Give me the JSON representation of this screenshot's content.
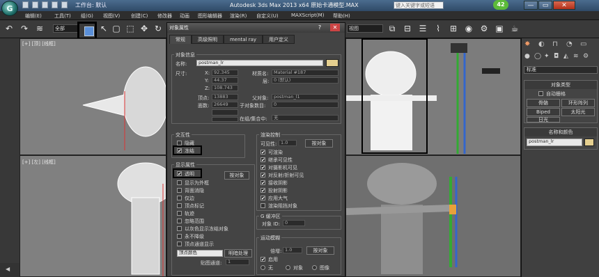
{
  "titlebar": {
    "app_badge": "G",
    "workspace": "工作台: 默认",
    "title": "Autodesk 3ds Max  2013 x64     原始卡通模型.MAX",
    "search_placeholder": "键入关键字或短语",
    "timer": "42",
    "min": "—",
    "max": "▭",
    "close": "✕"
  },
  "menu": [
    "编辑(E)",
    "工具(T)",
    "组(G)",
    "视图(V)",
    "创建(C)",
    "修改器",
    "动画",
    "图形编辑器",
    "渲染(R)",
    "自定义(U)",
    "MAXScript(M)",
    "帮助(H)"
  ],
  "toolbar": {
    "filter": "全部",
    "ref_coord": "视图",
    "icons": [
      "undo-icon",
      "redo-icon",
      "link-icon",
      "unlink-icon",
      "bind-icon",
      "select-icon",
      "cursor-icon",
      "rect-select-icon",
      "window-icon",
      "move-icon",
      "rotate-icon"
    ]
  },
  "viewports": {
    "top_left_label": "[+] [顶] [线框]",
    "bottom_left_label": "[+] [左] [线框]"
  },
  "dialog": {
    "title": "对象属性",
    "help": "?",
    "close": "✕",
    "tabs": [
      "常规",
      "高级照明",
      "mental ray",
      "用户定义"
    ],
    "info": {
      "group": "对象信息",
      "name_label": "名称:",
      "name_value": "postman_lr",
      "dims_label": "尺寸:",
      "x_label": "X:",
      "x": "92.345",
      "y_label": "Y:",
      "y": "44.37",
      "z_label": "Z:",
      "z": "108.743",
      "verts_label": "顶点:",
      "verts": "13883",
      "faces_label": "面数:",
      "faces": "26649",
      "material_label": "材质名:",
      "material": "Material #187",
      "layer_label": "层:",
      "layer": "0 (默认)",
      "parent_label": "父对象:",
      "parent": "postman_l1",
      "children_label": "子对象数目:",
      "children": "0",
      "group_label": "在组/集合中:",
      "group_value": "无"
    },
    "interactivity": {
      "group": "交互性",
      "hide": "隐藏",
      "freeze": "冻结"
    },
    "display": {
      "group": "显示属性",
      "see_through": "透明",
      "by_object": "按对象",
      "options": [
        "显示为外框",
        "背面消隐",
        "仅边",
        "顶点标记",
        "轨迹",
        "忽略范围",
        "以灰色显示冻结对象",
        "永不降级",
        "顶点通道显示"
      ],
      "vertex_color": "顶点颜色",
      "shaded": "明暗处理",
      "map_channel_label": "贴图通道:",
      "map_channel": "1"
    },
    "render": {
      "group": "渲染控制",
      "visibility_label": "可见性:",
      "visibility": "1.0",
      "by_object": "按对象",
      "options": [
        "可渲染",
        "继承可见性",
        "对摄影机可见",
        "对反射/折射可见",
        "接收阴影",
        "投射阴影",
        "应用大气",
        "渲染阻挡对象"
      ]
    },
    "gbuffer": {
      "group": "G 缓冲区",
      "object_id_label": "对象 ID:",
      "object_id": "0"
    },
    "motion_blur": {
      "group": "运动模糊",
      "multiplier_label": "倍增:",
      "multiplier": "1.0",
      "by_object": "按对象",
      "enabled": "启用",
      "none": "无",
      "object": "对象",
      "image": "图像"
    }
  },
  "command_panel": {
    "dropdown": "标准",
    "object_type": {
      "header": "对象类型",
      "autogrid": "自动栅格",
      "buttons": [
        "骨骼",
        "环形阵列",
        "Biped",
        "太阳光",
        "日光"
      ]
    },
    "name_color": {
      "header": "名称和颜色",
      "name": "postman_lr"
    }
  },
  "colors": {
    "accent": "#e5cf8f",
    "viewport": "#808080",
    "panel": "#444444",
    "highlight": "#5a8fd8"
  }
}
